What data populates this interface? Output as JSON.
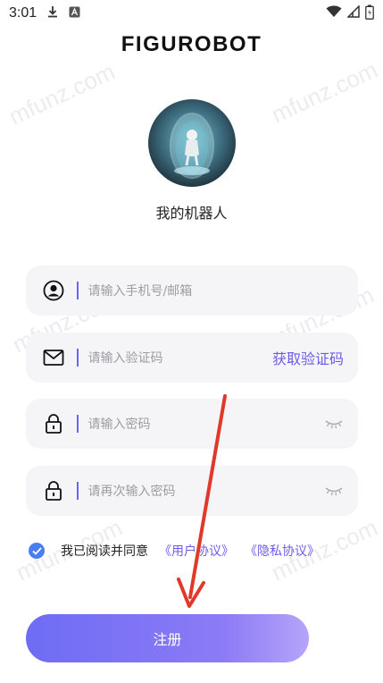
{
  "status_bar": {
    "time": "3:01"
  },
  "app": {
    "logo": "FIGUROBOT"
  },
  "profile": {
    "name": "我的机器人"
  },
  "form": {
    "phone_email_placeholder": "请输入手机号/邮箱",
    "code_placeholder": "请输入验证码",
    "get_code_label": "获取验证码",
    "password_placeholder": "请输入密码",
    "confirm_password_placeholder": "请再次输入密码"
  },
  "agreement": {
    "text": "我已阅读并同意",
    "user_agreement": "《用户协议》",
    "privacy_policy": "《隐私协议》",
    "checked": true
  },
  "register_button": {
    "label": "注册"
  },
  "watermark": {
    "text": "mfunz.com"
  },
  "colors": {
    "accent": "#6c5ce7",
    "checkbox": "#4a7ef0",
    "annotation_arrow": "#e0392b"
  }
}
